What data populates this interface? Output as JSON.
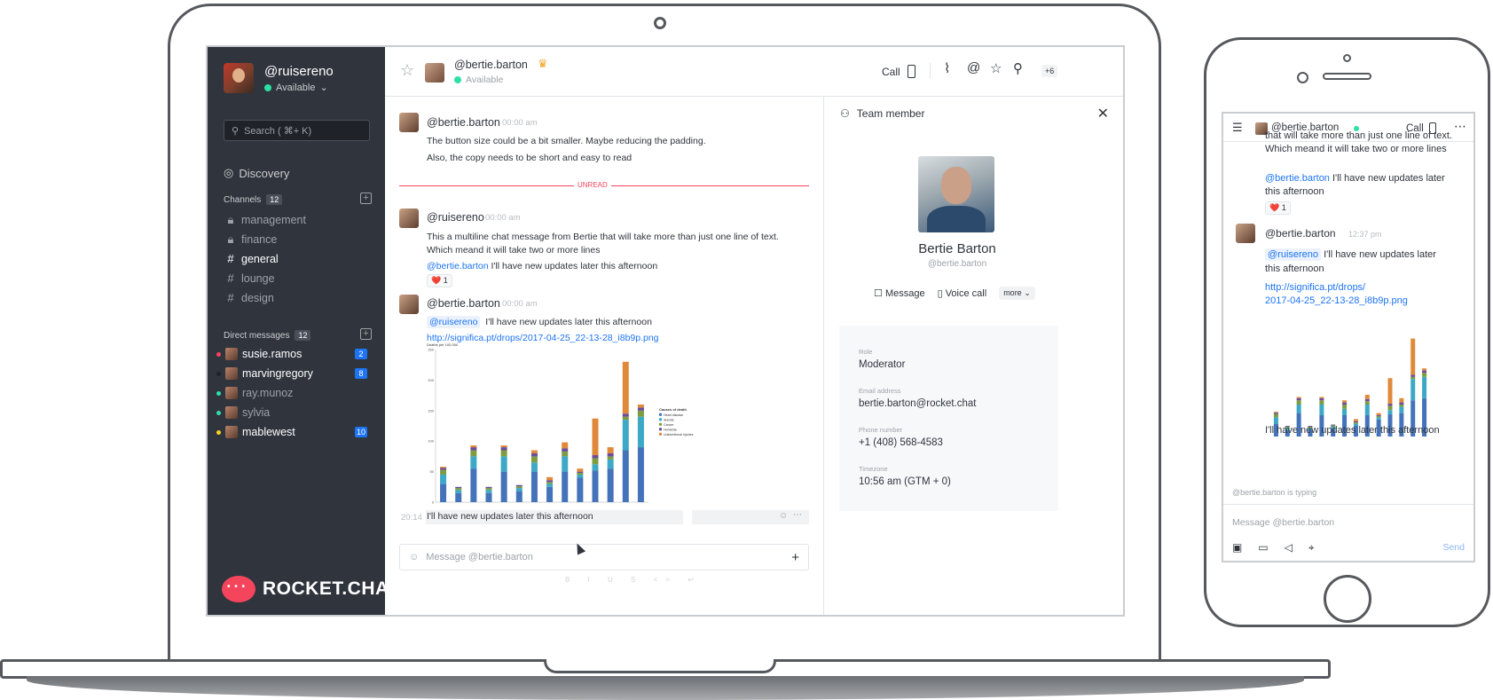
{
  "sidebar": {
    "username": "@ruisereno",
    "status": "Available",
    "search_placeholder": "Search ( ⌘+ K)",
    "discovery": "Discovery",
    "channels_label": "Channels",
    "channels_count": "12",
    "channels": [
      {
        "name": "management",
        "icon": "lock-icon",
        "active": false
      },
      {
        "name": "finance",
        "icon": "lock-icon",
        "active": false
      },
      {
        "name": "general",
        "icon": "hash-icon",
        "active": true
      },
      {
        "name": "lounge",
        "icon": "hash-icon",
        "active": false
      },
      {
        "name": "design",
        "icon": "hash-icon",
        "active": false
      }
    ],
    "dm_label": "Direct messages",
    "dm_count": "12",
    "dms": [
      {
        "name": "susie.ramos",
        "unread": "2",
        "status_color": "#f5455c"
      },
      {
        "name": "marvingregory",
        "unread": "8",
        "status_color": "#2f343d"
      },
      {
        "name": "ray.munoz",
        "unread": "",
        "status_color": "#2de0a5"
      },
      {
        "name": "sylvia",
        "unread": "",
        "status_color": "#2de0a5"
      },
      {
        "name": "mablewest",
        "unread": "10",
        "status_color": "#ffd21f"
      }
    ],
    "logo_text": "ROCKET.CHAT"
  },
  "header": {
    "name": "@bertie.barton",
    "status": "Available",
    "call_label": "Call",
    "more_label": "+6"
  },
  "messages": {
    "m1_user": "@bertie.barton",
    "m1_time": "00:00 am",
    "m1_line1": "The button size could be a bit smaller. Maybe reducing the padding.",
    "m1_line2": "Also, the copy needs to be short and easy to read",
    "unread_label": "UNREAD",
    "m2_user": "@ruisereno",
    "m2_time": "00:00 am",
    "m2_line1": "This a multiline chat message from Bertie that will take more than just one line of text.",
    "m2_line2": "Which meand it will take two or more lines",
    "m2_mention": "@bertie.barton",
    "m2_line3": " I'll have new updates later this afternoon",
    "m2_reaction": "❤️ 1",
    "m3_user": "@bertie.barton",
    "m3_time": "00:00 am",
    "m3_mention": "@ruisereno",
    "m3_line1": "I'll have new updates later this afternoon",
    "m3_link": "http://significa.pt/drops/2017-04-25_22-13-28_i8b9p.png",
    "m4_time": "20:14",
    "m4_text": "I'll have new updates later this afternoon",
    "composer_placeholder": "Message @bertie.barton",
    "format_bar": "B I U S <> ↩"
  },
  "panel": {
    "title": "Team member",
    "name": "Bertie Barton",
    "handle": "@bertie.barton",
    "action_message": "Message",
    "action_call": "Voice call",
    "action_more": "more",
    "role_label": "Role",
    "role_value": "Moderator",
    "email_label": "Email address",
    "email_value": "bertie.barton@rocket.chat",
    "phone_label": "Phone number",
    "phone_value": "+1 (408) 568-4583",
    "tz_label": "Timezone",
    "tz_value": "10:56 am (GTM + 0)"
  },
  "phone": {
    "header_name": "@bertie.barton",
    "call_label": "Call",
    "top_line1": "that will take more than just one line of text.",
    "top_line2": "Which meand it will take two or more lines",
    "msg1_mention": "@bertie.barton",
    "msg1_line1": " I'll have new updates later",
    "msg1_line2": "this afternoon",
    "reaction": "❤️ 1",
    "msg2_user": "@bertie.barton",
    "msg2_time": "12:37 pm",
    "msg2_mention": "@ruisereno",
    "msg2_line1": " I'll have new updates later",
    "msg2_line2": "this afternoon",
    "link_line1": "http://significa.pt/drops/",
    "link_line2": "2017-04-25_22-13-28_i8b9p.png",
    "after_chart": "I'll have new updates later this afternoon",
    "typing": "@bertie.barton is typing",
    "composer_placeholder": "Message @bertie.barton",
    "send_label": "Send"
  },
  "chart_data": {
    "type": "bar",
    "categories": [
      "1",
      "2",
      "3",
      "4",
      "5",
      "6",
      "7",
      "8",
      "9",
      "10",
      "11",
      "12",
      "13",
      "14"
    ],
    "series": [
      {
        "name": "Heart disease",
        "values": [
          30,
          15,
          55,
          15,
          50,
          18,
          50,
          25,
          50,
          40,
          52,
          55,
          85,
          90
        ]
      },
      {
        "name": "Suicide",
        "values": [
          15,
          5,
          20,
          5,
          25,
          5,
          15,
          5,
          25,
          5,
          10,
          15,
          50,
          50
        ]
      },
      {
        "name": "Cancer",
        "values": [
          8,
          3,
          10,
          3,
          10,
          3,
          10,
          3,
          8,
          3,
          10,
          5,
          5,
          10
        ]
      },
      {
        "name": "Homicide",
        "values": [
          3,
          2,
          5,
          2,
          5,
          2,
          5,
          3,
          5,
          2,
          5,
          5,
          5,
          5
        ]
      },
      {
        "name": "Unintentional injuries",
        "values": [
          2,
          0,
          3,
          0,
          3,
          0,
          5,
          5,
          10,
          5,
          60,
          10,
          85,
          5
        ]
      }
    ],
    "colors": [
      "#4473b9",
      "#3da9c7",
      "#7e9c42",
      "#6a4e9a",
      "#e1893a"
    ],
    "title": "Deaths per 100,000",
    "legend_title": "Causes of death",
    "ylim": [
      0,
      250
    ],
    "yticks": [
      0,
      50,
      100,
      150,
      200,
      250
    ],
    "legend_position": "right"
  }
}
